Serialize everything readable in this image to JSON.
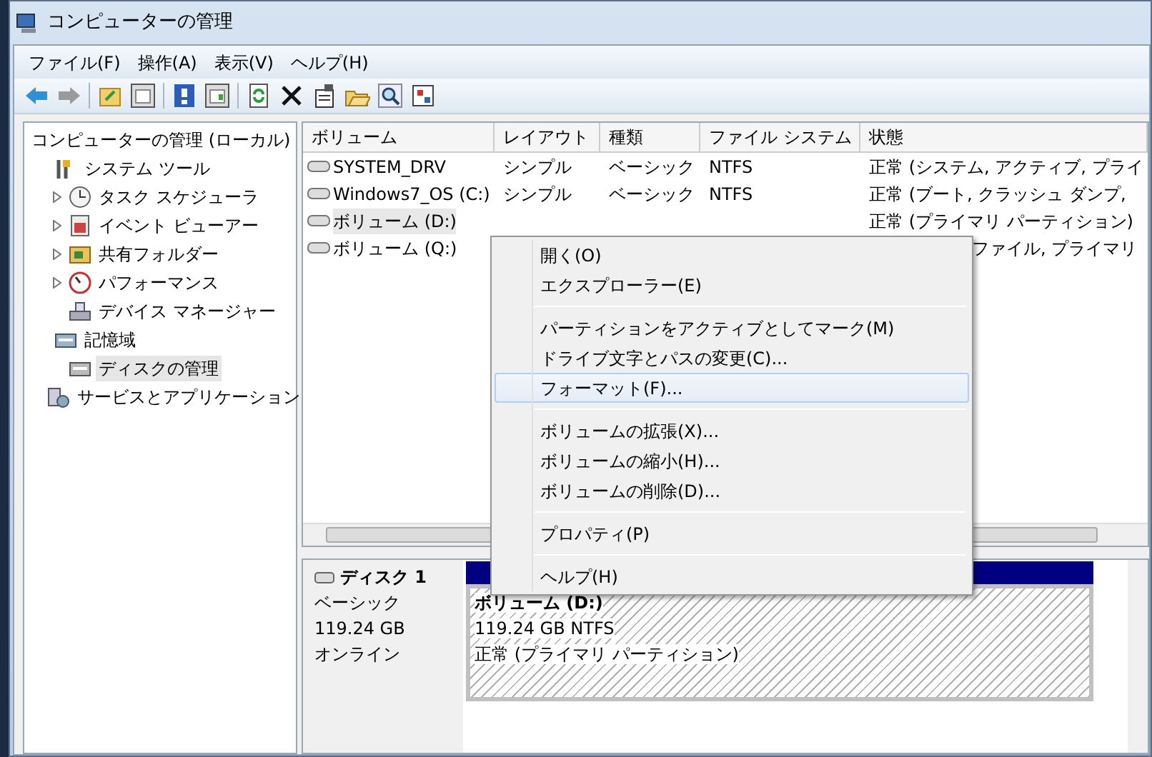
{
  "window": {
    "title": "コンピューターの管理"
  },
  "menu_bar": [
    "ファイル(F)",
    "操作(A)",
    "表示(V)",
    "ヘルプ(H)"
  ],
  "tree": {
    "label": "コンピューターの管理 (ローカル)",
    "selected": false,
    "expander": false,
    "children": [
      {
        "label": "システム ツール",
        "selected": false,
        "expander": false,
        "children": [
          {
            "label": "タスク スケジューラ",
            "selected": false,
            "expander": true
          },
          {
            "label": "イベント ビューアー",
            "selected": false,
            "expander": true
          },
          {
            "label": "共有フォルダー",
            "selected": false,
            "expander": true
          },
          {
            "label": "パフォーマンス",
            "selected": false,
            "expander": true
          },
          {
            "label": "デバイス マネージャー",
            "selected": false,
            "expander": false
          }
        ]
      },
      {
        "label": "記憶域",
        "selected": false,
        "expander": false,
        "children": [
          {
            "label": "ディスクの管理",
            "selected": true,
            "expander": false
          }
        ]
      },
      {
        "label": "サービスとアプリケーション",
        "selected": false,
        "expander": false
      }
    ]
  },
  "volume_table": {
    "columns": [
      "ボリューム",
      "レイアウト",
      "種類",
      "ファイル システム",
      "状態"
    ],
    "rows": [
      {
        "cells": [
          "SYSTEM_DRV",
          "シンプル",
          "ベーシック",
          "NTFS",
          "正常 (システム, アクティブ, プライ"
        ],
        "selected": false
      },
      {
        "cells": [
          "Windows7_OS (C:)",
          "シンプル",
          "ベーシック",
          "NTFS",
          "正常 (ブート, クラッシュ ダンプ,"
        ],
        "selected": false
      },
      {
        "cells": [
          "ボリューム (D:)",
          "",
          "",
          "",
          "正常 (プライマリ パーティション)"
        ],
        "selected": true
      },
      {
        "cells": [
          "ボリューム (Q:)",
          "",
          "",
          "",
          "ファイル, プライマリ"
        ],
        "selected": false
      }
    ]
  },
  "disk": {
    "name": "ディスク 1",
    "type": "ベーシック",
    "size": "119.24 GB",
    "status": "オンライン",
    "partition": {
      "name": "ボリューム (D:)",
      "size": "119.24 GB NTFS",
      "status": "正常 (プライマリ パーティション)"
    }
  },
  "context_menu": {
    "groups": [
      [
        {
          "label": "開く(O)",
          "selected": false
        },
        {
          "label": "エクスプローラー(E)",
          "selected": false
        }
      ],
      [
        {
          "label": "パーティションをアクティブとしてマーク(M)",
          "selected": false
        },
        {
          "label": "ドライブ文字とパスの変更(C)...",
          "selected": false
        },
        {
          "label": "フォーマット(F)...",
          "selected": true
        }
      ],
      [
        {
          "label": "ボリュームの拡張(X)...",
          "selected": false
        },
        {
          "label": "ボリュームの縮小(H)...",
          "selected": false
        },
        {
          "label": "ボリュームの削除(D)...",
          "selected": false
        }
      ],
      [
        {
          "label": "プロパティ(P)",
          "selected": false
        }
      ],
      [
        {
          "label": "ヘルプ(H)",
          "selected": false
        }
      ]
    ]
  }
}
